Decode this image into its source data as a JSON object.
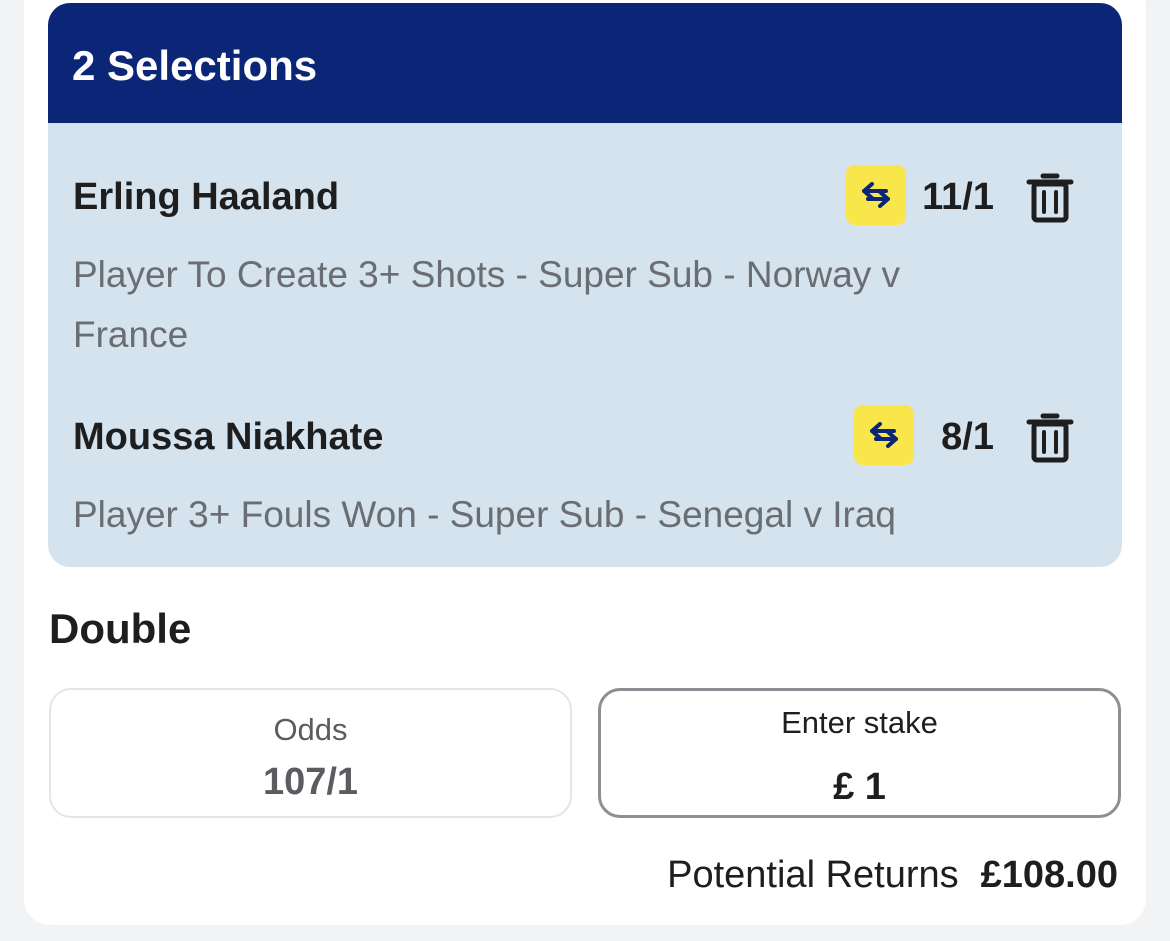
{
  "header": {
    "title": "2 Selections"
  },
  "selections": [
    {
      "name": "Erling Haaland",
      "description": "Player To Create 3+ Shots - Super Sub - Norway v France",
      "odds": "11/1"
    },
    {
      "name": "Moussa Niakhate",
      "description": "Player 3+ Fouls Won - Super Sub - Senegal v Iraq",
      "odds": "8/1"
    }
  ],
  "bet": {
    "type_label": "Double",
    "odds_label": "Odds",
    "odds_value": "107/1",
    "stake_label": "Enter stake",
    "stake_value": "£ 1",
    "returns_label": "Potential Returns",
    "returns_value": "£108.00"
  },
  "icons": {
    "swap": "swap-arrows-icon",
    "delete": "trash-icon"
  },
  "colors": {
    "header_bg": "#0c2677",
    "selections_bg": "#d4e3ee",
    "swap_bg": "#f8e64a"
  }
}
